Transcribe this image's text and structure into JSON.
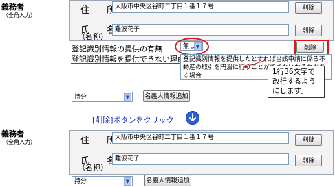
{
  "top_form": {
    "section_title": "義務者",
    "section_sub": "（全角入力）",
    "address_label": "住　所",
    "address_value": "大阪市中央区谷町二丁目１番１７号",
    "name_label": "氏　名",
    "name_sub": "（名称）",
    "name_value": "難波花子",
    "delete_label": "削除",
    "info_provided_label": "登記識別情報の提供の有無",
    "info_provided_value": "無し",
    "reason_label": "登記識別情報を提供できない理由",
    "reason_text": "登記識別情報を提供したとすれば当該申請に係る不動産の取引を円滑に行うことができないおそれがある場合",
    "share_value": "持分",
    "add_nominee_label": "名義人情報追加"
  },
  "callout": {
    "text": "1行36文字で改行するようにします。"
  },
  "instruction": {
    "prefix": "[削除]",
    "text": "ボタンをクリック",
    "arrow_icon": "arrow-down-circle-icon"
  },
  "bottom_form": {
    "section_title": "義務者",
    "section_sub": "（全角入力）",
    "address_label": "住　所",
    "address_value": "大阪市中央区谷町二丁目１番１７号",
    "name_label": "氏　名",
    "name_sub": "（名称）",
    "name_value": "難波花子",
    "delete_label": "削除",
    "share_value": "持分",
    "add_nominee_label": "名義人情報追加"
  },
  "colors": {
    "highlight_red": "#e01515",
    "link_blue": "#1a2fbf",
    "icon_blue": "#2a5fd8"
  }
}
